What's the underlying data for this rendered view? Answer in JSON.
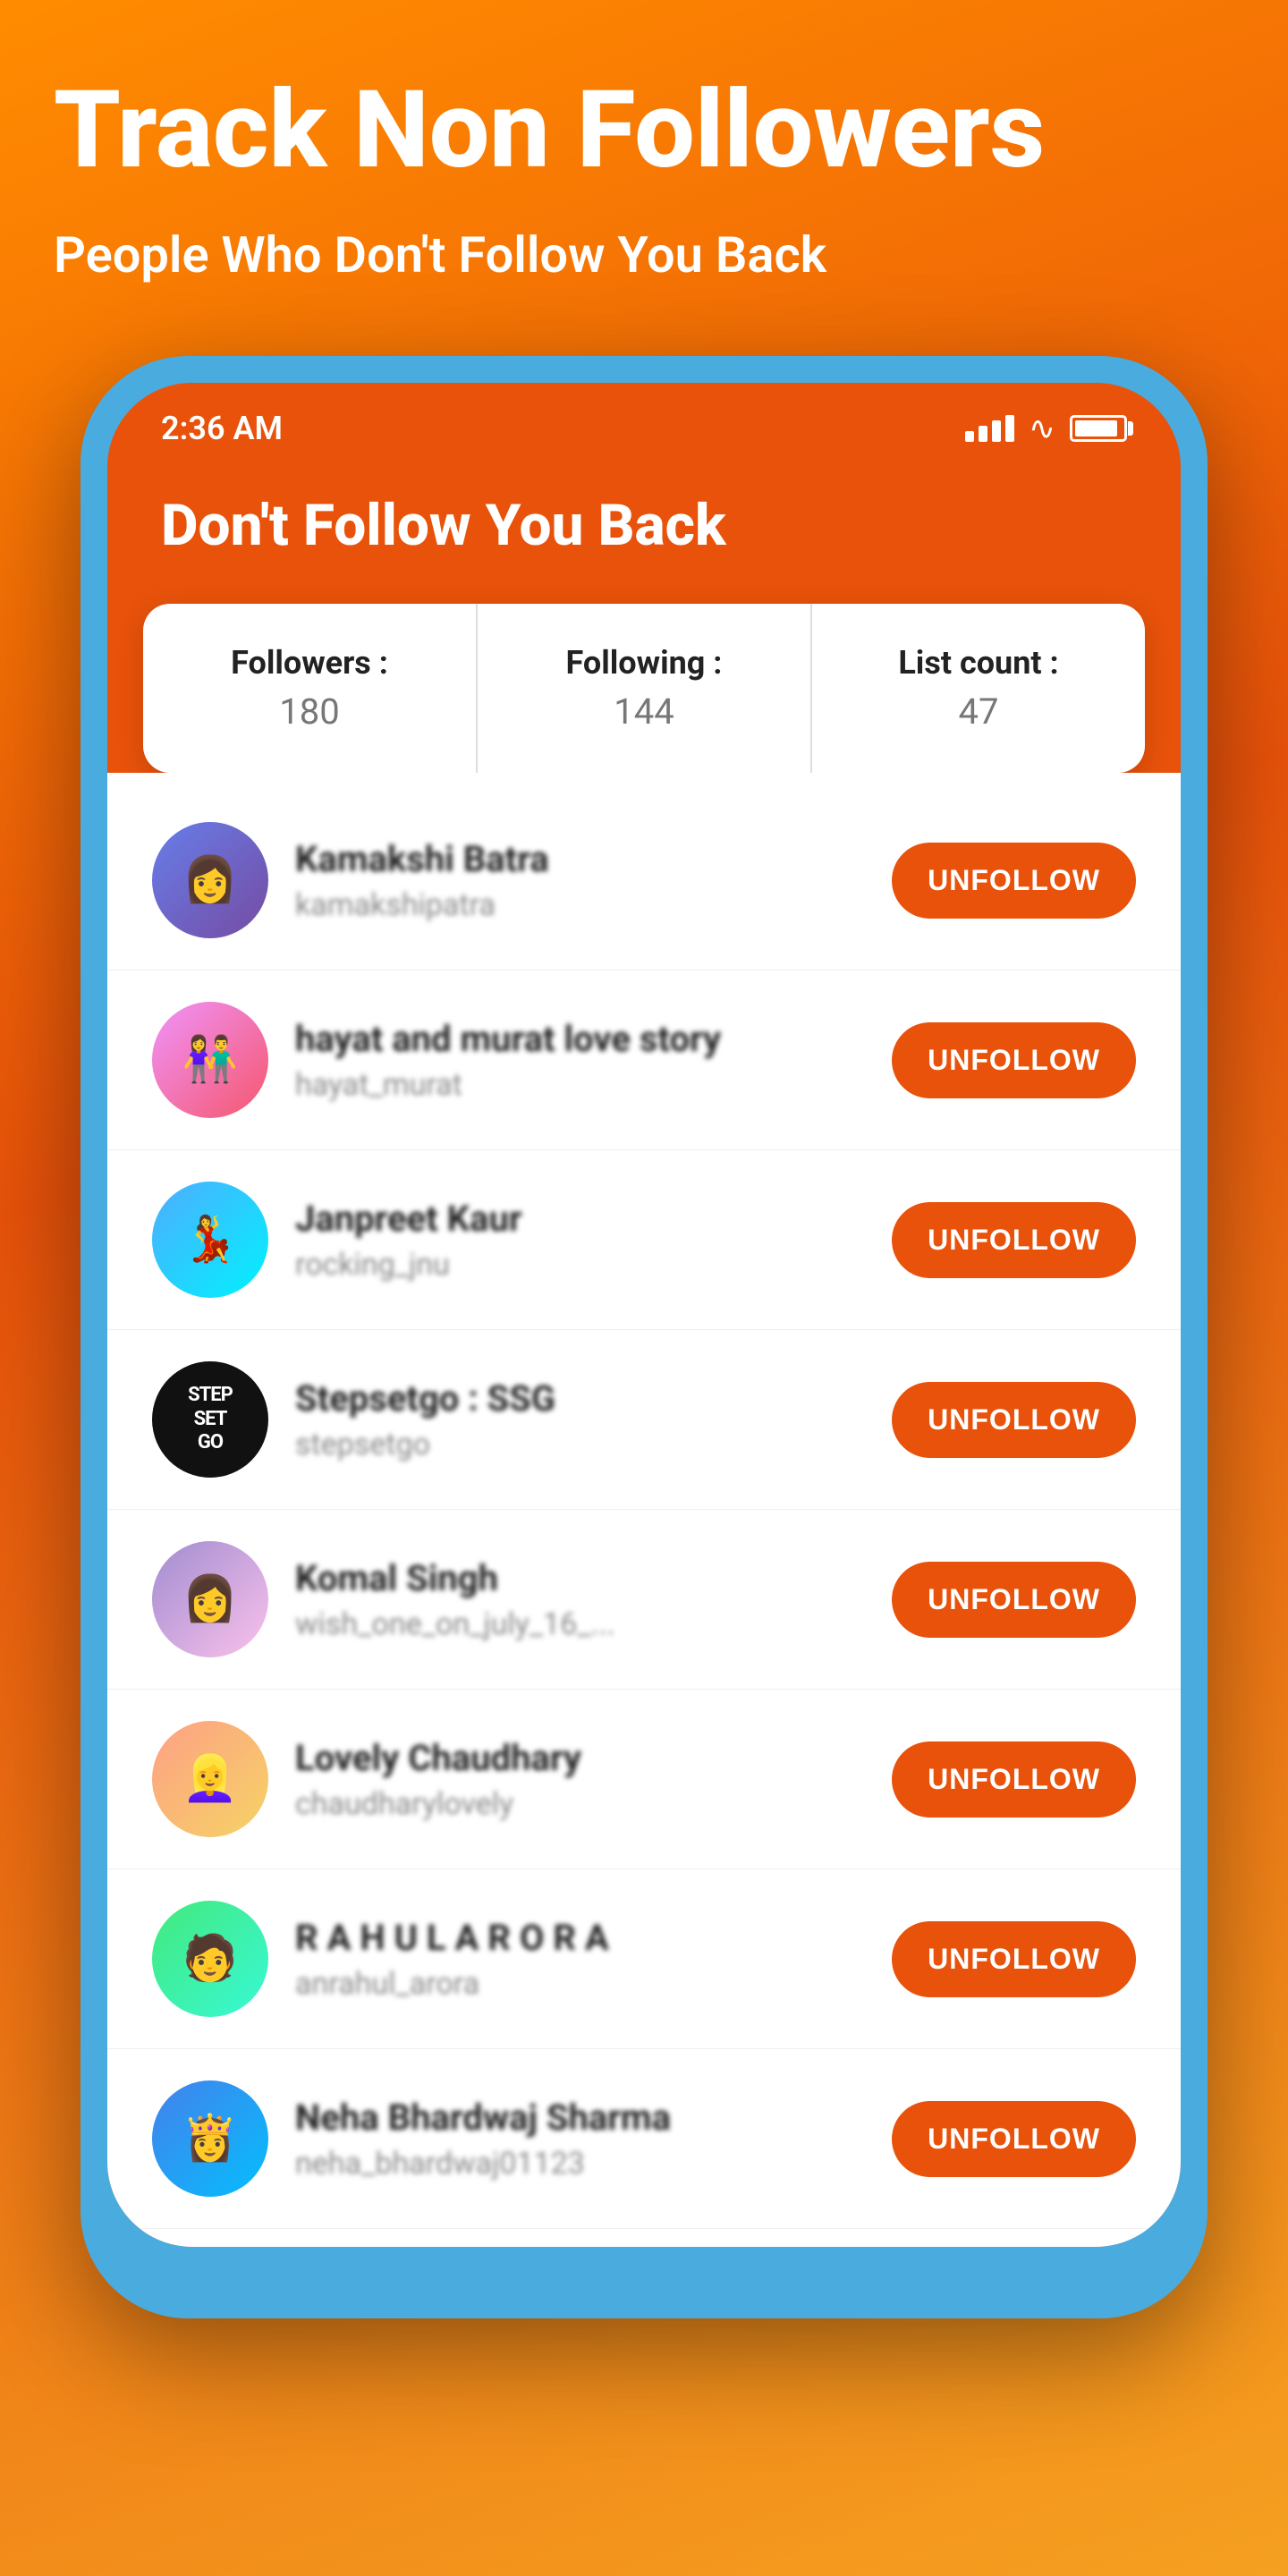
{
  "hero": {
    "title": "Track Non Followers",
    "subtitle": "People Who Don't Follow You Back"
  },
  "status_bar": {
    "time": "2:36 AM"
  },
  "app_header": {
    "title": "Don't Follow You Back"
  },
  "stats": [
    {
      "label": "Followers :",
      "value": "180"
    },
    {
      "label": "Following :",
      "value": "144"
    },
    {
      "label": "List count :",
      "value": "47"
    }
  ],
  "users": [
    {
      "name": "Kamakshi Batra",
      "handle": "kamakshipatra",
      "avatar_text": "👩",
      "avatar_class": "avatar-1"
    },
    {
      "name": "hayat and murat love story",
      "handle": "hayat_murat",
      "avatar_text": "👫",
      "avatar_class": "avatar-2"
    },
    {
      "name": "Janpreet Kaur",
      "handle": "rocking_jnu",
      "avatar_text": "💃",
      "avatar_class": "avatar-3"
    },
    {
      "name": "Stepsetgo : SSG",
      "handle": "stepsetgo",
      "avatar_text": "STEP\nSET\nGO",
      "avatar_class": "avatar-4",
      "is_text": true
    },
    {
      "name": "Komal Singh",
      "handle": "wish_one_on_july_16_...",
      "avatar_text": "👩",
      "avatar_class": "avatar-5"
    },
    {
      "name": "Lovely Chaudhary",
      "handle": "chaudharylovely",
      "avatar_text": "👱‍♀️",
      "avatar_class": "avatar-6"
    },
    {
      "name": "R A H U L A R O R A",
      "handle": "anrahul_arora",
      "avatar_text": "🧑",
      "avatar_class": "avatar-7"
    },
    {
      "name": "Neha Bhardwaj Sharma",
      "handle": "neha_bhardwaj01123",
      "avatar_text": "👸",
      "avatar_class": "avatar-8"
    }
  ],
  "unfollow_label": "UNFOLLOW"
}
